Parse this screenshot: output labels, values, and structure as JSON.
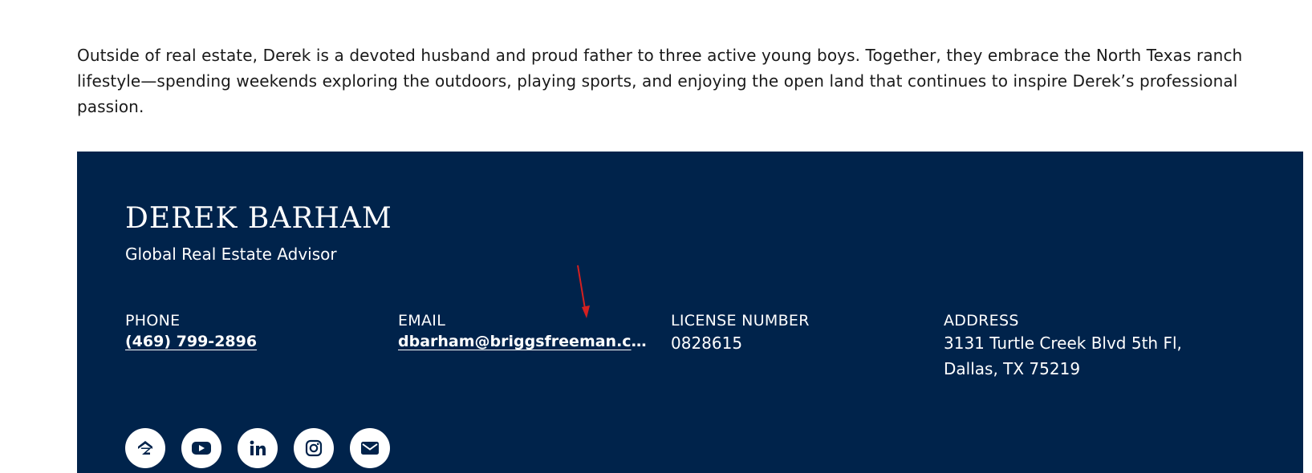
{
  "bio": {
    "text": "Outside of real estate, Derek is a devoted husband and proud father to three active young boys. Together, they embrace the North Texas ranch lifestyle—spending weekends exploring the outdoors, playing sports, and enjoying the open land that continues to inspire Derek’s professional passion."
  },
  "agent": {
    "name": "DEREK BARHAM",
    "title": "Global Real Estate Advisor"
  },
  "contact": {
    "phone_label": "PHONE",
    "phone_value": "(469) 799-2896",
    "email_label": "EMAIL",
    "email_value": "dbarham@briggsfreeman.com",
    "license_label": "LICENSE NUMBER",
    "license_value": "0828615",
    "address_label": "ADDRESS",
    "address_line1": "3131 Turtle Creek Blvd 5th Fl,",
    "address_line2": "Dallas, TX 75219"
  },
  "socials": [
    {
      "icon": "zillow-icon"
    },
    {
      "icon": "youtube-icon"
    },
    {
      "icon": "linkedin-icon"
    },
    {
      "icon": "instagram-icon"
    },
    {
      "icon": "mail-icon"
    }
  ],
  "colors": {
    "card_background": "#00234b",
    "icon_fill": "#00234b",
    "annotation_arrow": "#d42020"
  }
}
